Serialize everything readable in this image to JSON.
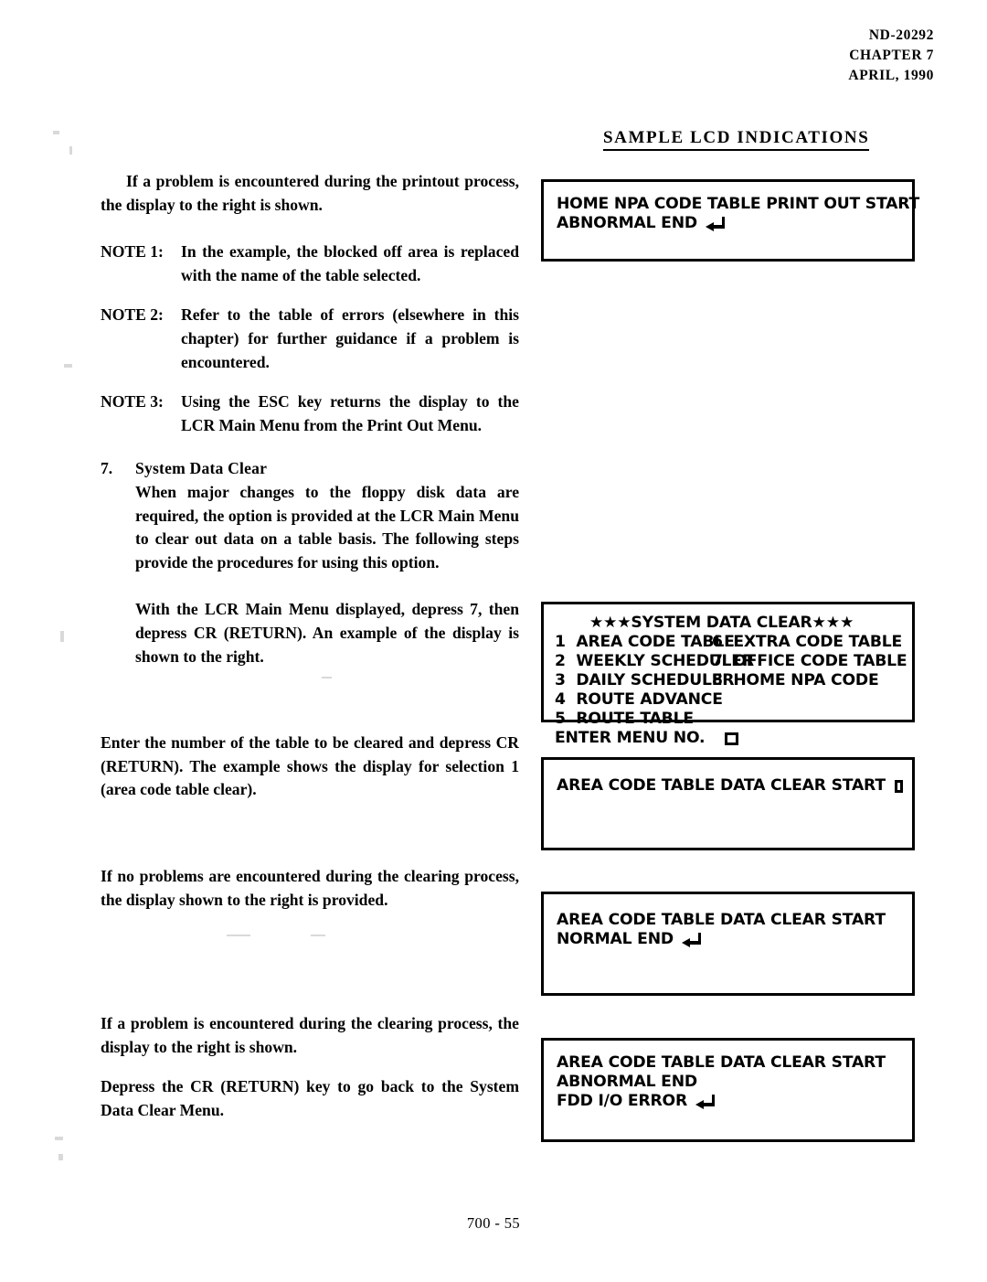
{
  "header": {
    "doc_number": "ND-20292",
    "chapter": "CHAPTER 7",
    "date": "APRIL, 1990"
  },
  "section_title": "SAMPLE LCD INDICATIONS",
  "body": {
    "intro_paragraph": "If a problem is encountered during the printout process, the display to the right is shown.",
    "notes": [
      {
        "label": "NOTE 1:",
        "text": "In the example, the blocked off area is replaced with the name of the table selected."
      },
      {
        "label": "NOTE 2:",
        "text": "Refer to the table of errors (elsewhere in this chapter) for further guidance if a problem is encountered."
      },
      {
        "label": "NOTE 3:",
        "text": "Using the ESC key returns the display to the LCR Main Menu from the Print Out Menu."
      }
    ],
    "section": {
      "number": "7.",
      "heading": "System Data Clear",
      "paragraph": "When major changes to the floppy disk data are required, the option is provided at the LCR Main Menu to clear out data on a table basis.   The following steps provide the procedures for using this option."
    },
    "paragraph_main_menu": "With the LCR Main Menu displayed, depress 7, then depress CR (RETURN).   An example of the display is shown to the right.",
    "paragraph_enter_number": "Enter the number of the table to be cleared and depress CR (RETURN).   The example shows the display for selection 1 (area code table clear).",
    "paragraph_no_problem": "If no problems are encountered during the clearing process, the display shown to the right is provided.",
    "paragraph_problem": "If a problem is encountered during the clearing process, the display to the right is shown.",
    "paragraph_depress_cr": "Depress the CR (RETURN) key to go back to the System Data Clear Menu."
  },
  "lcd_displays": {
    "printout_abnormal": {
      "line1": "HOME NPA CODE TABLE PRINT OUT START",
      "line2": "ABNORMAL END"
    },
    "system_data_clear_menu": {
      "title": "★★★SYSTEM DATA CLEAR★★★",
      "items": [
        {
          "num": "1",
          "label": "AREA CODE TABLE"
        },
        {
          "num": "2",
          "label": "WEEKLY SCHEDULER"
        },
        {
          "num": "3",
          "label": "DAILY SCHEDULER"
        },
        {
          "num": "4",
          "label": "ROUTE ADVANCE"
        },
        {
          "num": "5",
          "label": "ROUTE TABLE"
        },
        {
          "num": "6",
          "label": "EXTRA CODE TABLE"
        },
        {
          "num": "7",
          "label": "OFFICE CODE TABLE"
        },
        {
          "num": "8",
          "label": "HOME NPA CODE"
        }
      ],
      "prompt": "ENTER MENU NO."
    },
    "clear_start": {
      "line1": "AREA CODE TABLE DATA CLEAR START"
    },
    "clear_normal_end": {
      "line1": "AREA CODE TABLE DATA CLEAR START",
      "line2": "NORMAL END"
    },
    "clear_abnormal_end": {
      "line1": "AREA CODE TABLE DATA CLEAR START",
      "line2": "ABNORMAL END",
      "line3": "FDD I/O ERROR"
    }
  },
  "footer": {
    "page_number": "700 - 55"
  },
  "colors": {
    "ink": "#000000",
    "paper": "#ffffff"
  }
}
